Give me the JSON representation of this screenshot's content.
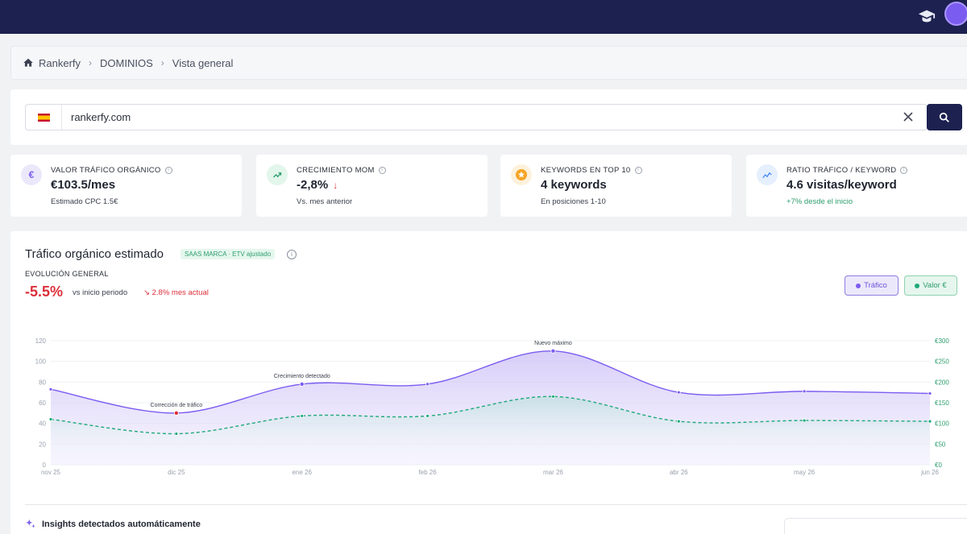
{
  "breadcrumb": {
    "items": [
      "Rankerfy",
      "DOMINIOS",
      "Vista general"
    ]
  },
  "search": {
    "value": "rankerfy.com",
    "country": "ES"
  },
  "cards": [
    {
      "label": "VALOR TRÁFICO ORGÁNICO",
      "value": "€103.5/mes",
      "sub": "Estimado CPC 1.5€",
      "icon": "euro-icon",
      "color": "#7b5cf0"
    },
    {
      "label": "CRECIMIENTO MOM",
      "value": "-2,8%",
      "sub": "Vs. mes anterior",
      "icon": "trending-up-icon",
      "color": "#2e9e6e"
    },
    {
      "label": "KEYWORDS EN TOP 10",
      "value": "4 keywords",
      "sub": "En posiciones 1-10",
      "icon": "star-icon",
      "color": "#f5a524"
    },
    {
      "label": "RATIO TRÁFICO / KEYWORD",
      "value": "4.6 visitas/keyword",
      "sub": "+7% desde el inicio",
      "icon": "trend-chart-icon",
      "color": "#3b82f6"
    }
  ],
  "chart_panel": {
    "title": "Tráfico orgánico estimado",
    "tag": "SAAS MARCA · ETV ajustado",
    "evolution_label": "EVOLUCIÓN GENERAL",
    "change": "-5.5%",
    "change_caption": "vs inicio periodo",
    "month_change": "2.8% mes actual",
    "legend_traffic": "Tráfico",
    "legend_value": "Valor €"
  },
  "chart_data": {
    "type": "area",
    "categories": [
      "nov 25",
      "dic 25",
      "ene 26",
      "feb 26",
      "mar 26",
      "abr 26",
      "may 26",
      "jun 26"
    ],
    "series": [
      {
        "name": "Tráfico",
        "axis": "left",
        "values": [
          73,
          50,
          78,
          78,
          110,
          70,
          71,
          69
        ],
        "color": "#7b5cf0"
      },
      {
        "name": "Valor €",
        "axis": "right",
        "values": [
          110,
          75,
          118,
          118,
          165,
          105,
          107,
          105
        ],
        "color": "#1fa97a"
      }
    ],
    "y_left": {
      "ticks": [
        "0",
        "20",
        "40",
        "60",
        "80",
        "100",
        "120"
      ],
      "min": 0,
      "max": 120
    },
    "y_right": {
      "ticks": [
        "€0",
        "€50",
        "€100",
        "€150",
        "€200",
        "€250",
        "€300"
      ],
      "min": 0,
      "max": 300
    },
    "annotations": [
      {
        "index": 1,
        "text": "Corrección de tráfico"
      },
      {
        "index": 2,
        "text": "Crecimiento detectado"
      },
      {
        "index": 4,
        "text": "Nuevo máximo"
      }
    ],
    "grid": true
  },
  "insights": {
    "title": "Insights detectados automáticamente"
  }
}
